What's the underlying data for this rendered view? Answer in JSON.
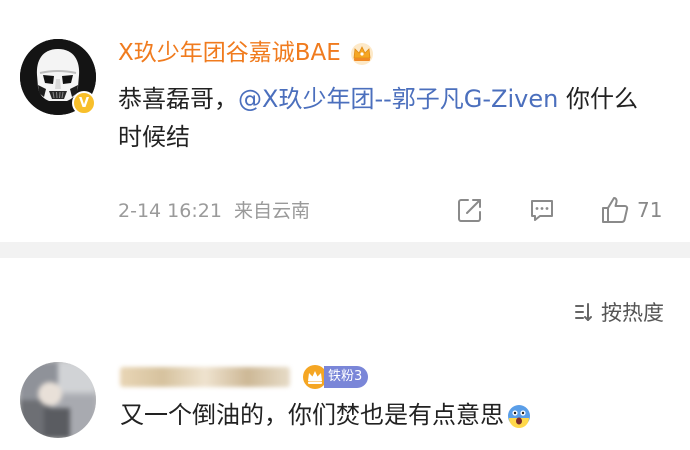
{
  "post": {
    "username": "X玖少年团谷嘉诚BAE",
    "text_before": "恭喜磊哥，",
    "mention": "@X玖少年团--郭子凡G-Ziven",
    "text_after": " 你什么时候结",
    "date": "2-14 16:21",
    "source": "来自云南",
    "like_count": "71",
    "verified_icon": "v-badge-icon",
    "crown_icon": "crown-icon",
    "colors": {
      "username": "#f07b1e",
      "mention": "#4b6fbd",
      "meta": "#9a9a9a"
    }
  },
  "sort": {
    "label": "按热度",
    "icon": "sort-icon"
  },
  "comment": {
    "fan_badge": "铁粉3",
    "text": "又一个倒油的，你们焚也是有点意思",
    "emoji_icon": "scared-emoji-icon"
  }
}
